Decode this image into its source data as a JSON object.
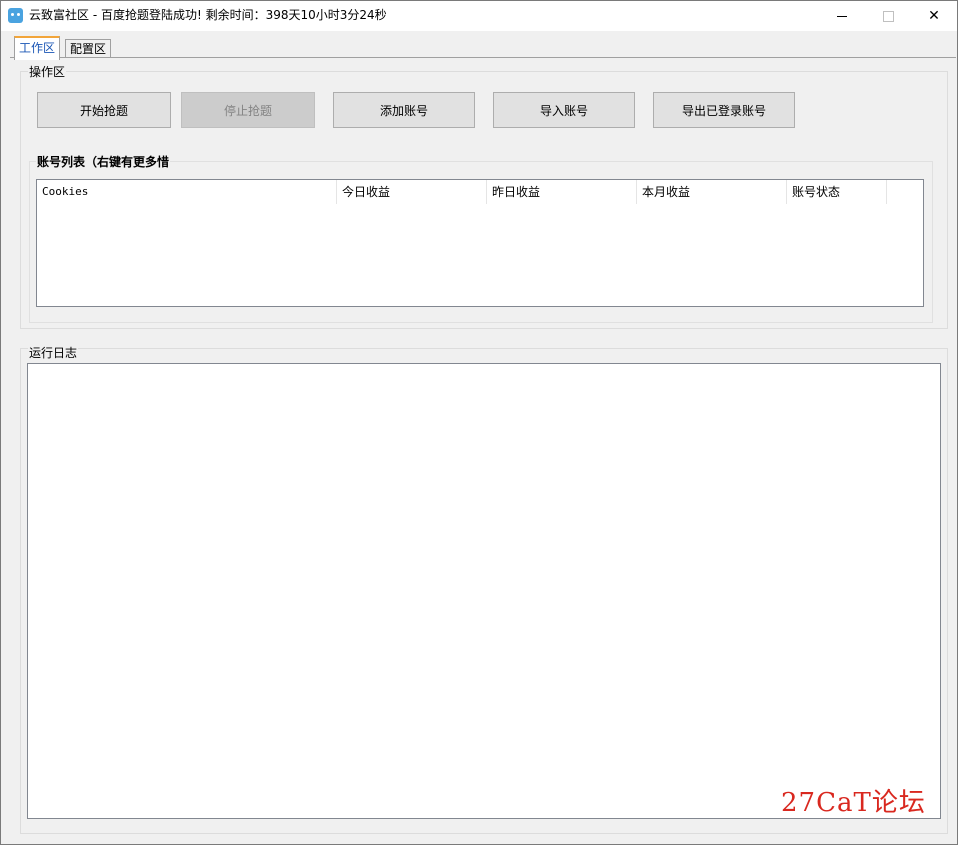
{
  "window": {
    "title": "云致富社区 - 百度抢题登陆成功! 剩余时间：398天10小时3分24秒",
    "minimize_label": "—",
    "maximize_label": "☐",
    "close_label": "✕",
    "icon": "app-icon"
  },
  "tabs": [
    {
      "label": "工作区",
      "active": true
    },
    {
      "label": "配置区",
      "active": false
    }
  ],
  "operation_group": {
    "label": "操作区",
    "buttons": [
      {
        "label": "开始抢题",
        "enabled": true
      },
      {
        "label": "停止抢题",
        "enabled": false
      },
      {
        "label": "添加账号",
        "enabled": true
      },
      {
        "label": "导入账号",
        "enabled": true
      },
      {
        "label": "导出已登录账号",
        "enabled": true
      }
    ]
  },
  "account_group": {
    "label": "账号列表（右键有更多惜",
    "columns": [
      "Cookies",
      "今日收益",
      "昨日收益",
      "本月收益",
      "账号状态"
    ],
    "rows": []
  },
  "log_group": {
    "label": "运行日志"
  },
  "watermark": {
    "text": "27CaT论坛",
    "color": "#d9281f"
  }
}
